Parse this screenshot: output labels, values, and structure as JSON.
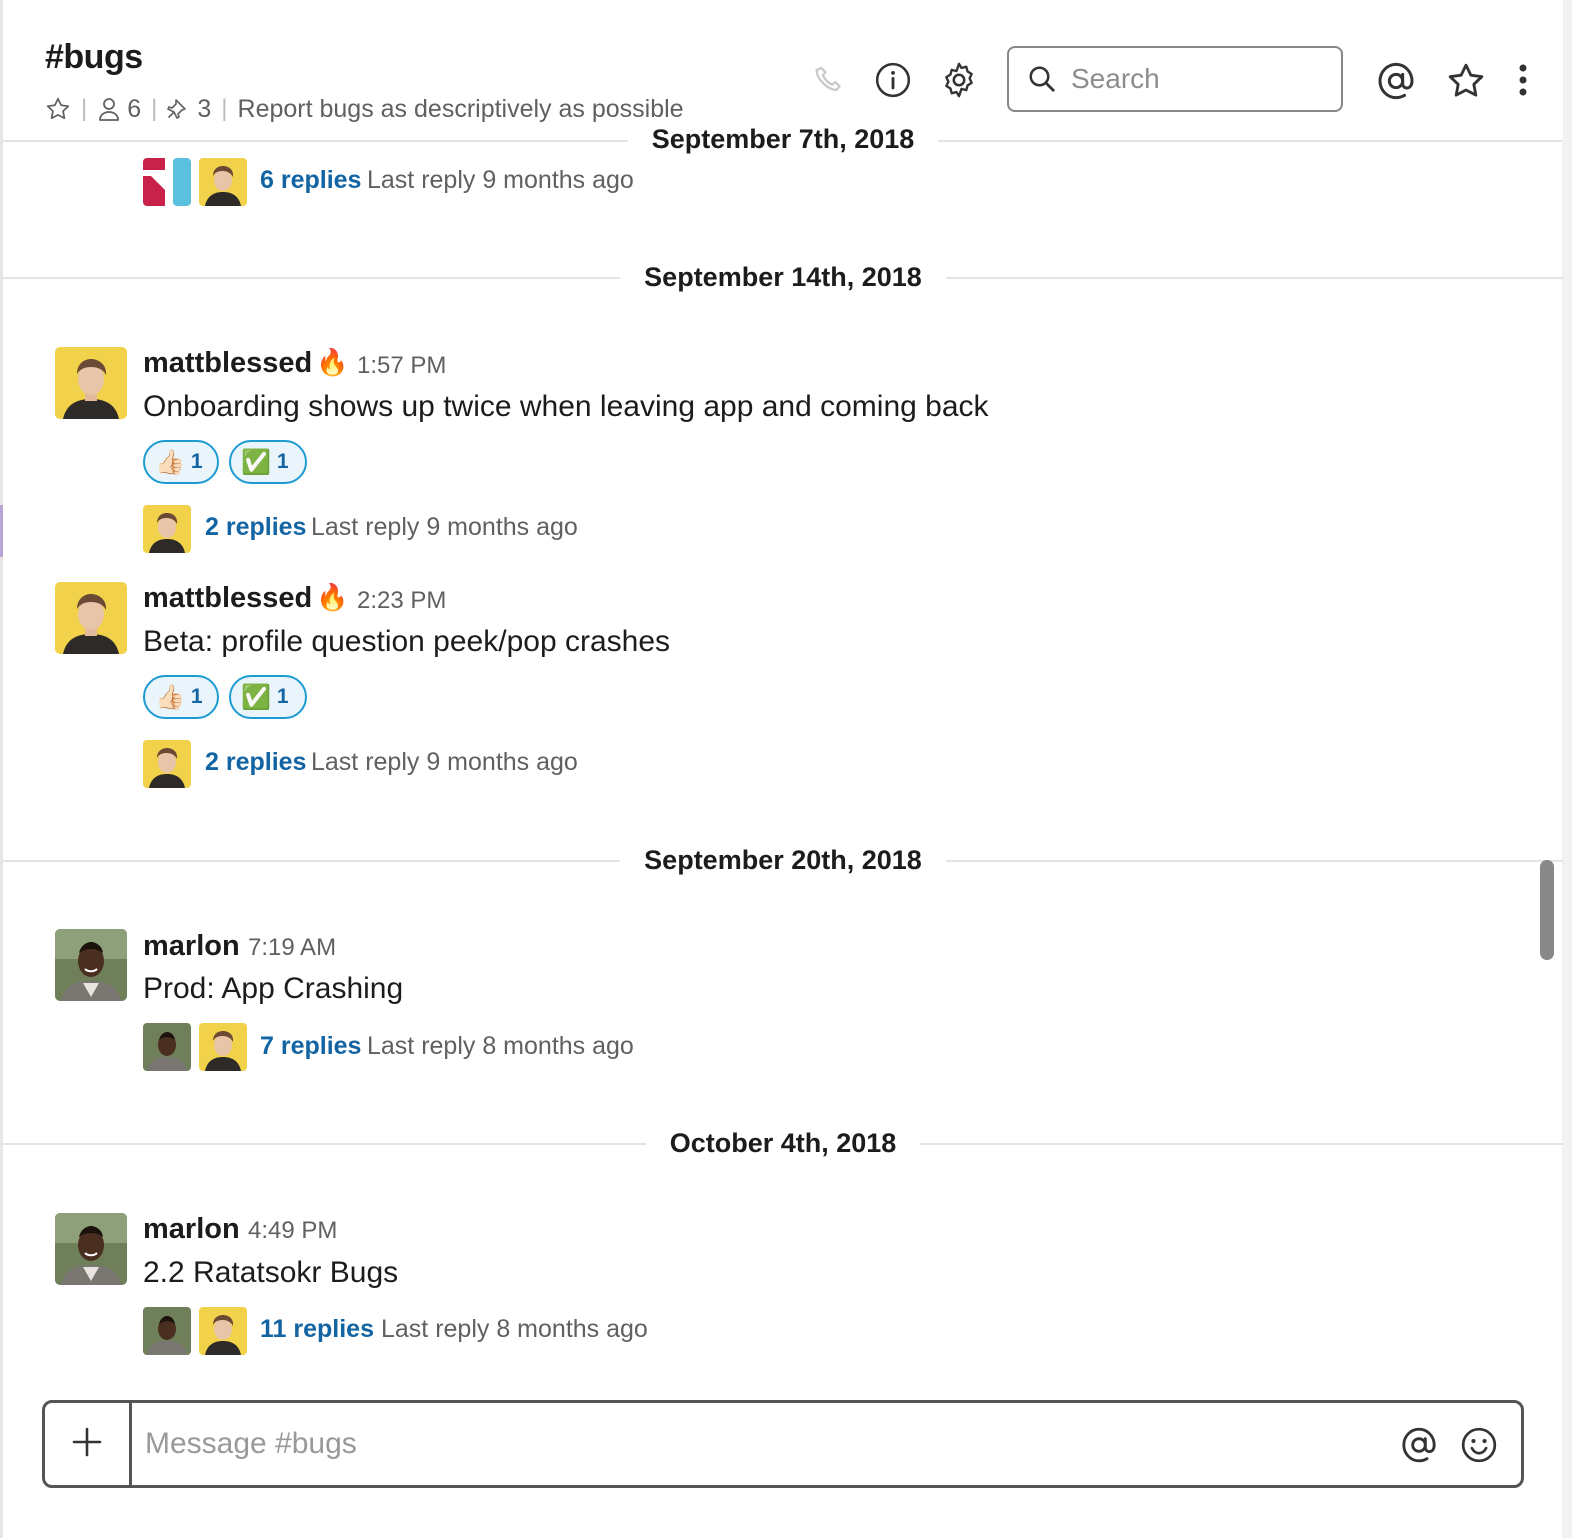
{
  "channel": {
    "title": "#bugs",
    "members_count": "6",
    "pinned_count": "3",
    "topic": "Report bugs as descriptively as possible"
  },
  "search": {
    "placeholder": "Search"
  },
  "top_thread": {
    "replies": "6 replies",
    "last_reply": "Last reply 9 months ago"
  },
  "dates": [
    "September 7th, 2018",
    "September 14th, 2018",
    "September 20th, 2018",
    "October 4th, 2018"
  ],
  "messages": [
    {
      "user": "mattblessed",
      "status_emoji": "🔥",
      "time": "1:57 PM",
      "text": "Onboarding shows up twice when leaving app and coming back",
      "reactions": [
        {
          "emoji": "👍🏻",
          "count": "1"
        },
        {
          "emoji": "✅",
          "count": "1"
        }
      ],
      "replies": "2 replies",
      "last_reply": "Last reply 9 months ago"
    },
    {
      "user": "mattblessed",
      "status_emoji": "🔥",
      "time": "2:23 PM",
      "text": "Beta: profile question peek/pop crashes",
      "reactions": [
        {
          "emoji": "👍🏻",
          "count": "1"
        },
        {
          "emoji": "✅",
          "count": "1"
        }
      ],
      "replies": "2 replies",
      "last_reply": "Last reply 9 months ago"
    },
    {
      "user": "marlon",
      "time": "7:19 AM",
      "text": "Prod: App Crashing",
      "replies": "7 replies",
      "last_reply": "Last reply 8 months ago"
    },
    {
      "user": "marlon",
      "time": "4:49 PM",
      "text": "2.2 Ratatsokr Bugs",
      "replies": "11 replies",
      "last_reply": "Last reply 8 months ago"
    }
  ],
  "composer": {
    "placeholder": "Message #bugs"
  },
  "icons": [
    "star-icon",
    "members-icon",
    "pin-icon",
    "phone-icon",
    "info-icon",
    "gear-icon",
    "search-icon",
    "mention-icon",
    "star-outline-icon",
    "more-vertical-icon",
    "plus-icon",
    "emoji-icon"
  ],
  "colors": {
    "link": "#1264a3",
    "reaction_border": "#1d9bd1",
    "reaction_bg": "#eaf5fb"
  }
}
